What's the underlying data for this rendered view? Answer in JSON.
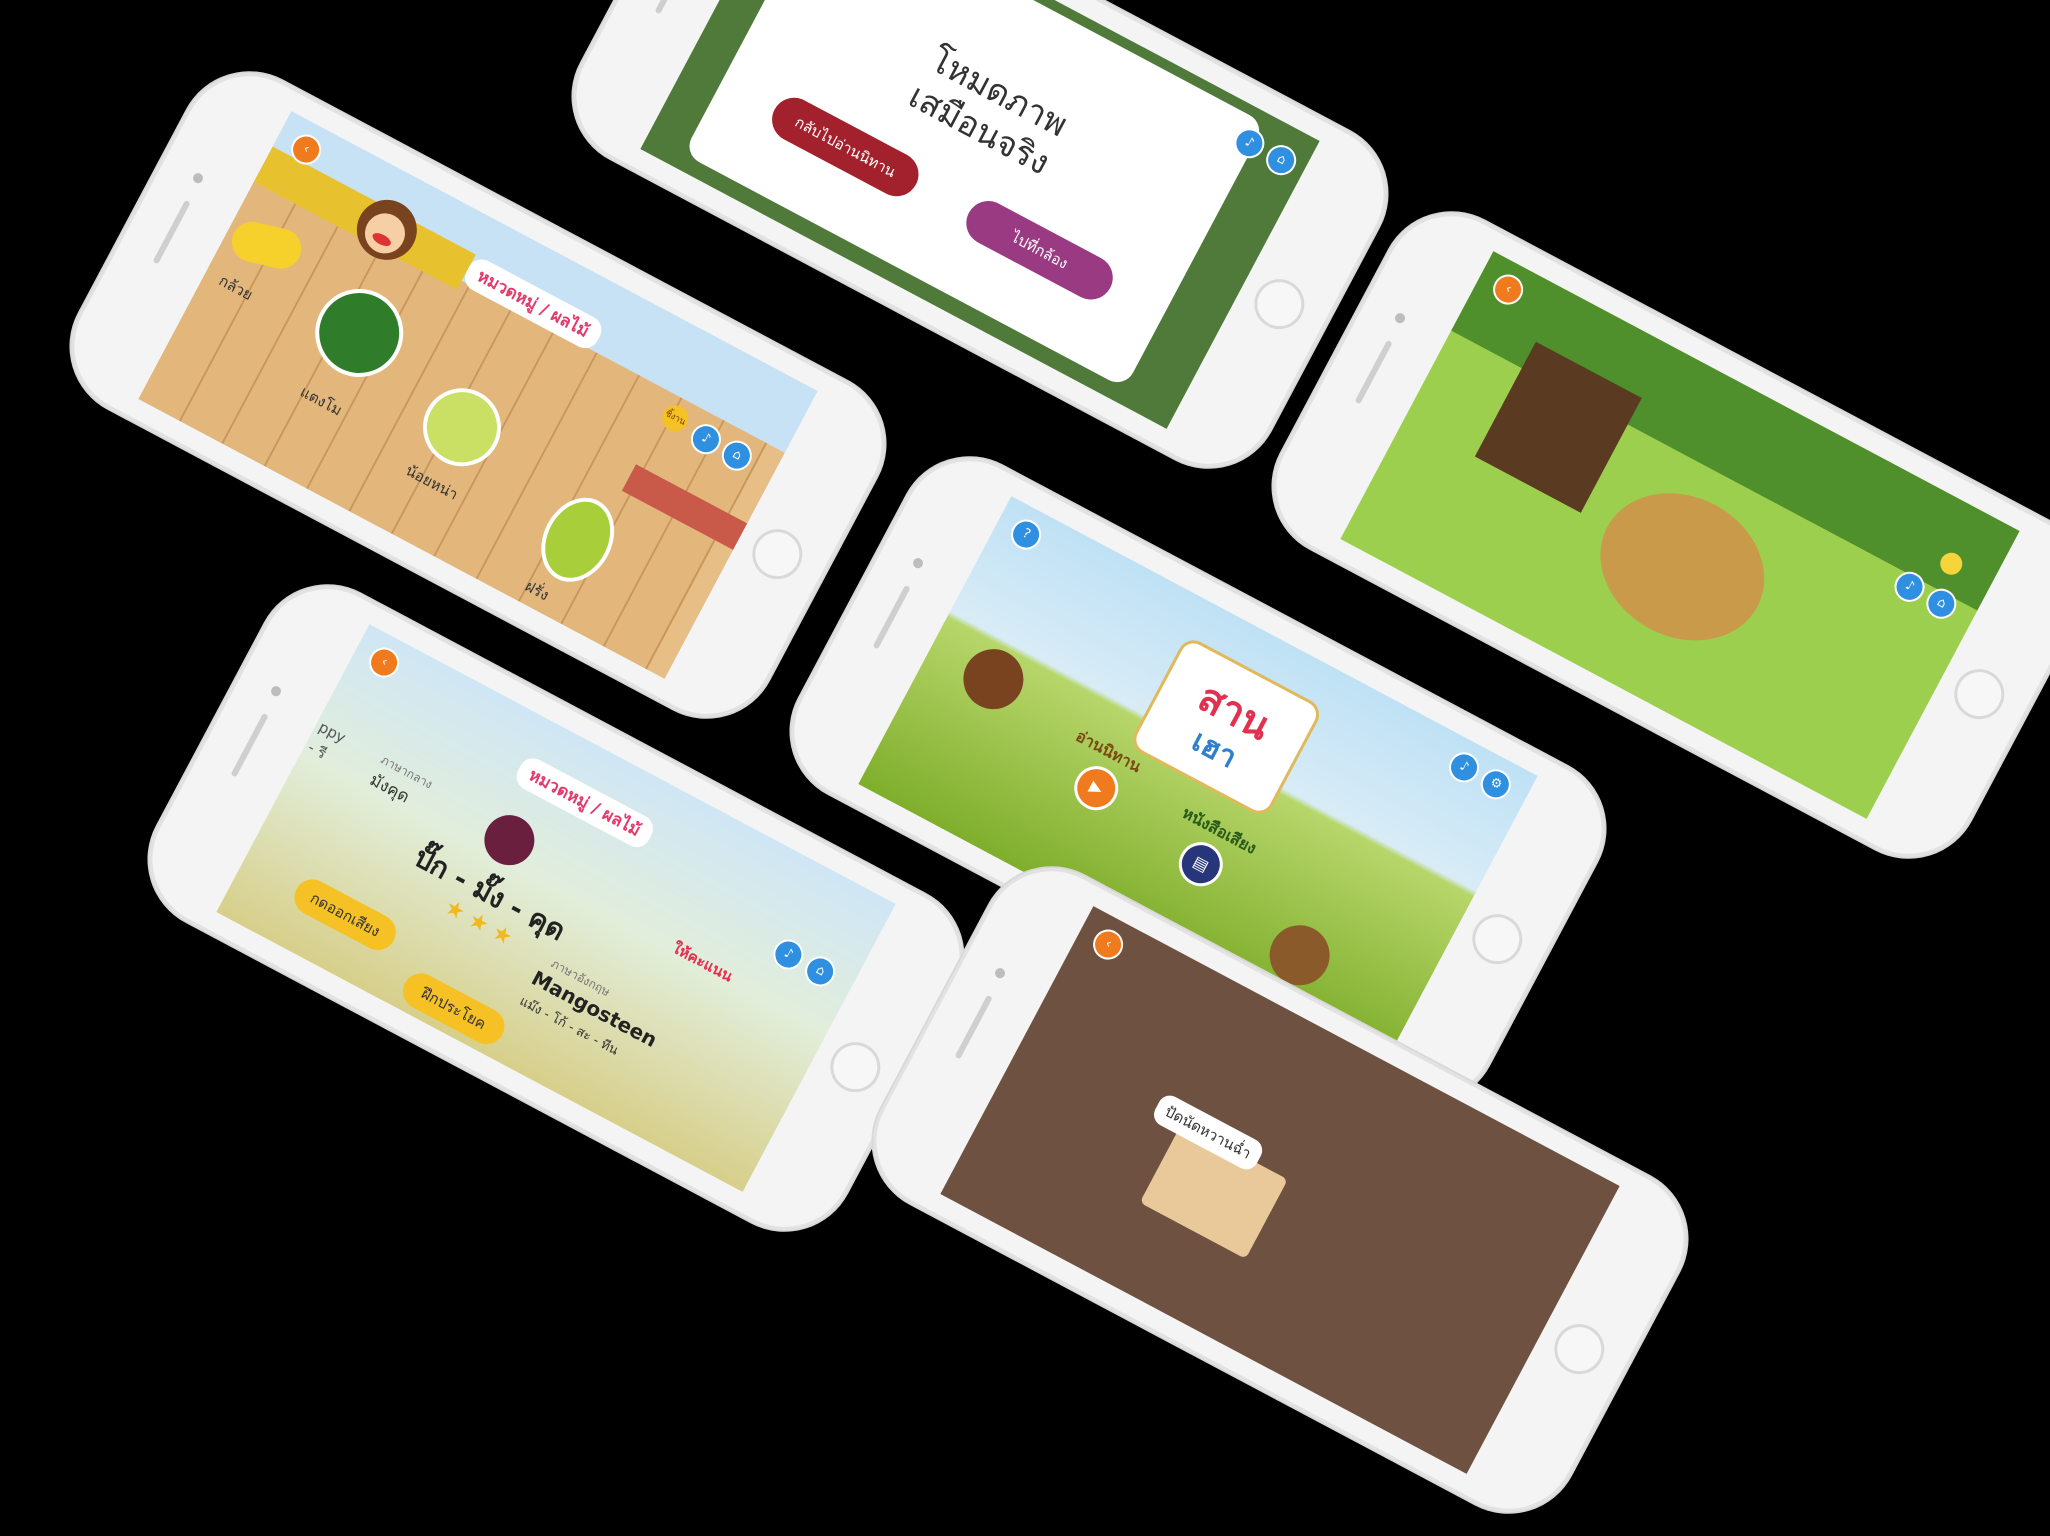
{
  "fruit_screen": {
    "title": "หมวดหมู่ / ผลไม้",
    "badge": "ชิ้งาน",
    "items": [
      {
        "label": "กล้วย"
      },
      {
        "label": "แตงโม"
      },
      {
        "label": "น้อยหน่า"
      },
      {
        "label": "ฝรั่ง"
      }
    ]
  },
  "ar_screen": {
    "title_line1": "โหมดภาพ",
    "title_line2": "เสมือนจริง",
    "back_button": "กลับไปอ่านนิทาน",
    "camera_button": "ไปที่กล้อง"
  },
  "home_screen": {
    "logo_top": "สาน",
    "logo_bottom": "เฮา",
    "read_story_label": "อ่านนิทาน",
    "audio_book_label": "หนังสือเสียง",
    "help_icon_text": "?"
  },
  "word_screen": {
    "title": "หมวดหมู่ / ผลไม้",
    "central_label": "ภาษากลาง",
    "central_word": "มังคุด",
    "left_word_partial": "ppy",
    "left_word_partial2": "- รี",
    "local_word": "ปั๊ก - มั๊ง - คุด",
    "english_label": "ภาษาอังกฤษ",
    "english_word": "Mangosteen",
    "english_phonetic": "แม๊ง - โก้ - สะ - ทีน",
    "score_label": "ให้คะแนน",
    "record_button": "กดออกเสียง",
    "practice_button": "ฝึกประโยค"
  },
  "photo_screen": {
    "caption": "ปัดนัดหวานฉ่ำ"
  }
}
